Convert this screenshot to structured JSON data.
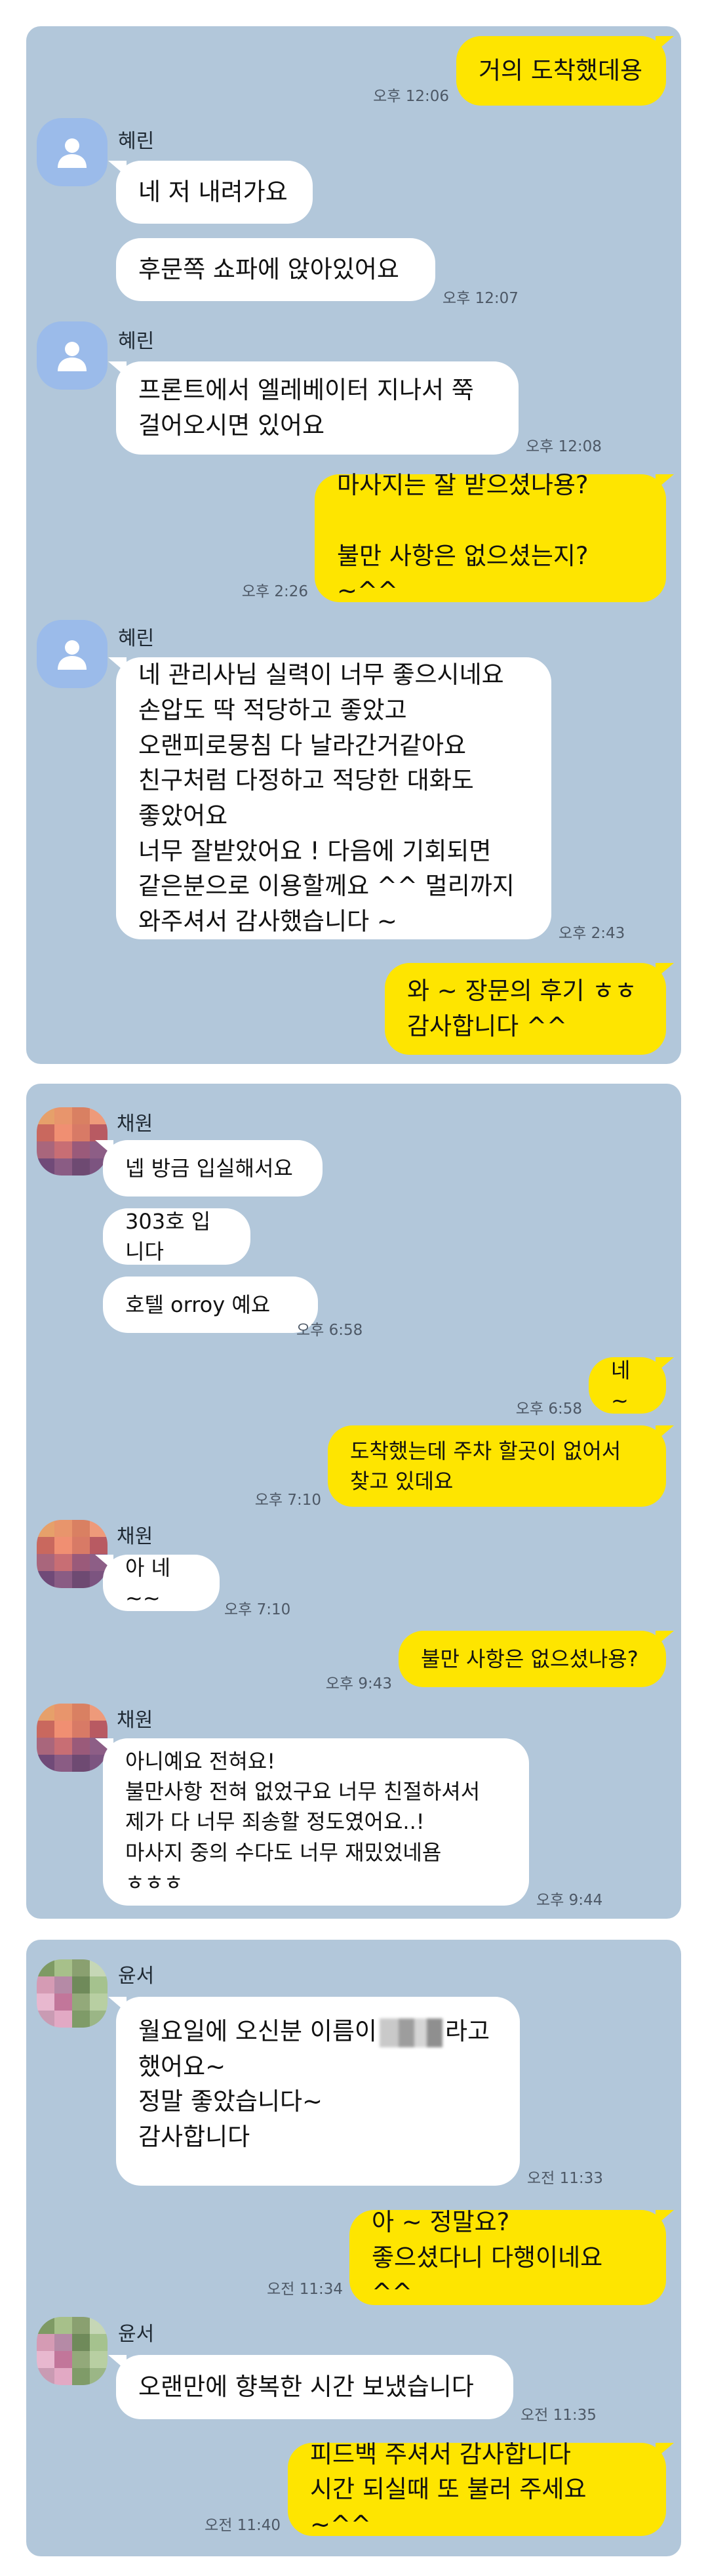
{
  "panels": [
    {
      "contact_name": "혜린",
      "messages": [
        {
          "from": "me",
          "text": "거의 도착했데용",
          "time": "오후 12:06"
        },
        {
          "from": "you",
          "text": "네 저 내려가요"
        },
        {
          "from": "you",
          "text": "후문쪽 쇼파에 앉아있어요",
          "time": "오후 12:07"
        },
        {
          "from": "you",
          "text": "프론트에서 엘레베이터 지나서 쭉\n걸어오시면 있어요",
          "time": "오후 12:08"
        },
        {
          "from": "me",
          "text": "마사지는 잘 받으셨나용?\n\n불만 사항은 없으셨는지? ~^^",
          "time": "오후 2:26"
        },
        {
          "from": "you",
          "text": "네 관리사님 실력이 너무 좋으시네요\n손압도 딱 적당하고 좋았고\n오랜피로뭉침 다 날라간거같아요\n친구처럼 다정하고 적당한 대화도\n좋았어요\n너무 잘받았어요 ! 다음에 기회되면\n같은분으로 이용할께요 ^^ 멀리까지\n와주셔서 감사했습니다 ~",
          "time": "오후 2:43"
        },
        {
          "from": "me",
          "text": "와 ~ 장문의 후기 ㅎㅎ\n감사합니다 ^^"
        }
      ]
    },
    {
      "contact_name": "채원",
      "messages": [
        {
          "from": "you",
          "text": "넵 방금 입실해서요"
        },
        {
          "from": "you",
          "text": "303호 입니다"
        },
        {
          "from": "you",
          "text": "호텔 orroy 예요",
          "time": "오후 6:58"
        },
        {
          "from": "me",
          "text": "네 ~",
          "time": "오후 6:58"
        },
        {
          "from": "me",
          "text": "도착했는데  주차 할곳이 없어서\n찾고 있데요",
          "time": "오후 7:10"
        },
        {
          "from": "you",
          "text": "아 네~~",
          "time": "오후 7:10"
        },
        {
          "from": "me",
          "text": "불만 사항은 없으셨나용?",
          "time": "오후 9:43"
        },
        {
          "from": "you",
          "text": "아니예요 전혀요!\n불만사항 전혀 없었구요 너무 친절하셔서\n제가 다 너무 죄송할 정도였어요..!\n마사지 중의 수다도 너무 재밌었네욤\nㅎㅎㅎ",
          "time": "오후 9:44"
        }
      ]
    },
    {
      "contact_name": "윤서",
      "messages": [
        {
          "from": "you",
          "text_before": "월요일에 오신분 이름이",
          "text_after": "라고\n했어요~\n정말 좋았습니다~\n감사합니다",
          "time": "오전 11:33"
        },
        {
          "from": "me",
          "text": "아 ~ 정말요?\n좋으셨다니 다행이네요 ^^",
          "time": "오전 11:34"
        },
        {
          "from": "you",
          "text": "오랜만에 향복한 시간 보냈습니다",
          "time": "오전 11:35"
        },
        {
          "from": "me",
          "text": "피드백 주셔서 감사합니다\n시간 되실때 또 불러 주세요 ~^^",
          "time": "오전 11:40"
        }
      ]
    }
  ]
}
